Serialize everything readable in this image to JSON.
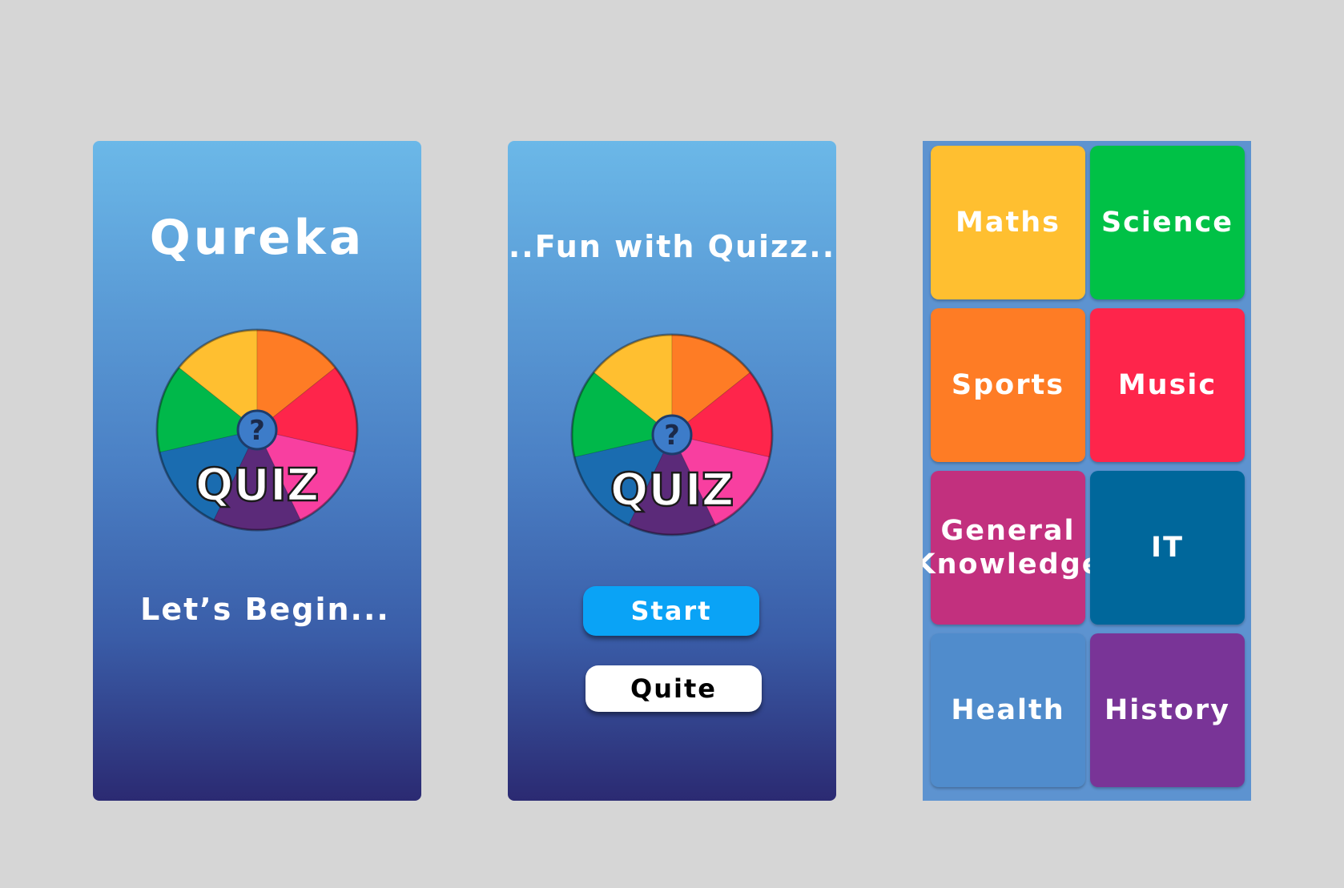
{
  "screen1": {
    "logo": "Qureka",
    "begin_text": "Let’s Begin...",
    "badge_text": "QUIZ",
    "badge_symbol": "?"
  },
  "screen2": {
    "heading": "..Fun with Quizz..",
    "badge_text": "QUIZ",
    "badge_symbol": "?",
    "start_label": "Start",
    "quit_label": "Quite"
  },
  "screen3": {
    "categories": [
      {
        "label": "Maths",
        "color": "#ffbf30"
      },
      {
        "label": "Science",
        "color": "#00c146"
      },
      {
        "label": "Sports",
        "color": "#fe7c25"
      },
      {
        "label": "Music",
        "color": "#fe254b"
      },
      {
        "label": "General Knowledge",
        "color": "#c2307e"
      },
      {
        "label": "IT",
        "color": "#00679b"
      },
      {
        "label": "Health",
        "color": "#508ccc"
      },
      {
        "label": "History",
        "color": "#793497"
      }
    ]
  },
  "colors": {
    "wheel_yellow": "#ffbf30",
    "wheel_orange": "#fe7c25",
    "wheel_red": "#fe254b",
    "wheel_pink": "#f83fa0",
    "wheel_purple": "#5b2a79",
    "wheel_blue": "#1a6cb0",
    "wheel_green": "#00b84a",
    "hub": "#3d7cc9"
  }
}
